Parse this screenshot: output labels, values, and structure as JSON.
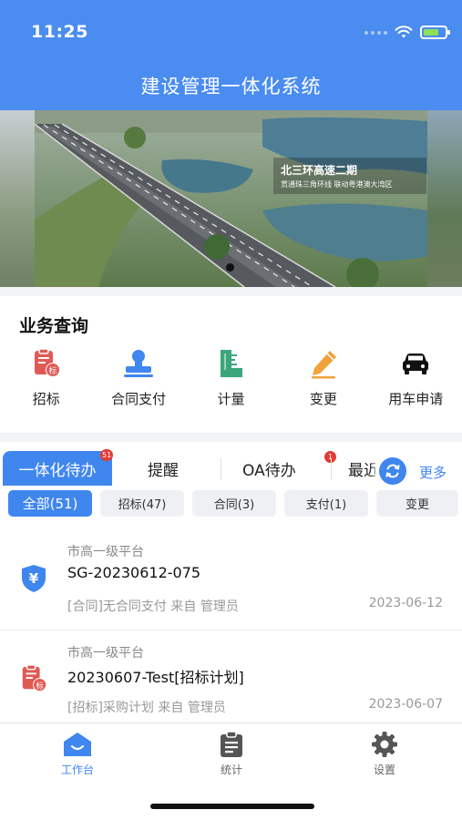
{
  "status_bar": {
    "time": "11:25"
  },
  "header": {
    "title": "建设管理一体化系统"
  },
  "banner": {
    "caption_title": "北三环高速二期",
    "caption_subtitle": "贯通珠三角环线 联动粤港澳大湾区"
  },
  "business": {
    "title": "业务查询",
    "items": [
      {
        "label": "招标",
        "icon": "bidding-icon",
        "color": "#e05a55"
      },
      {
        "label": "合同支付",
        "icon": "stamp-icon",
        "color": "#3f86ef"
      },
      {
        "label": "计量",
        "icon": "measure-icon",
        "color": "#3aa77a"
      },
      {
        "label": "变更",
        "icon": "pencil-icon",
        "color": "#f0a33a"
      },
      {
        "label": "用车申请",
        "icon": "car-icon",
        "color": "#111111"
      }
    ]
  },
  "tabs": {
    "items": [
      {
        "label": "一体化待办",
        "badge": "51"
      },
      {
        "label": "提醒",
        "badge": ""
      },
      {
        "label": "OA待办",
        "badge": "1"
      },
      {
        "label": "最近",
        "badge": ""
      }
    ],
    "more_label": "更多"
  },
  "filters": [
    {
      "label": "全部(51)",
      "active": true
    },
    {
      "label": "招标(47)",
      "active": false
    },
    {
      "label": "合同(3)",
      "active": false
    },
    {
      "label": "支付(1)",
      "active": false
    },
    {
      "label": "变更",
      "active": false
    }
  ],
  "list": [
    {
      "platform": "市高一级平台",
      "title": "SG-20230612-075",
      "desc": "[合同]无合同支付  来自 管理员",
      "date": "2023-06-12",
      "icon": "yen-shield-icon"
    },
    {
      "platform": "市高一级平台",
      "title": "20230607-Test[招标计划]",
      "desc": "[招标]采购计划  来自 管理员",
      "date": "2023-06-07",
      "icon": "bidding-icon"
    }
  ],
  "tabbar": {
    "items": [
      {
        "label": "工作台",
        "icon": "workbench-icon",
        "active": true
      },
      {
        "label": "统计",
        "icon": "clipboard-icon",
        "active": false
      },
      {
        "label": "设置",
        "icon": "gear-icon",
        "active": false
      }
    ]
  },
  "colors": {
    "primary": "#3f86ef",
    "header": "#4a8cf0",
    "badge": "#e23b35"
  }
}
